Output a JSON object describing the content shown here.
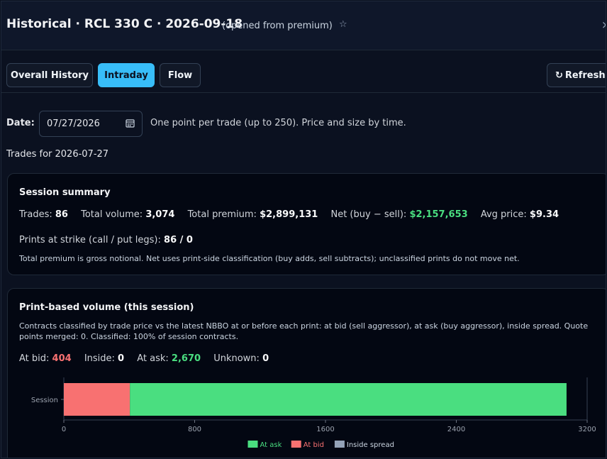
{
  "header": {
    "title": "Historical · RCL 330 C · 2026-09-18",
    "subtitle": "(opened from premium)",
    "star_icon": "☆",
    "close_icon": "×"
  },
  "tabs": [
    {
      "label": "Overall History",
      "active": false
    },
    {
      "label": "Intraday",
      "active": true
    },
    {
      "label": "Flow",
      "active": false
    }
  ],
  "refresh": {
    "icon": "↻",
    "label": "Refresh"
  },
  "date": {
    "label": "Date:",
    "value": "07/27/2026",
    "hint": "One point per trade (up to 250). Price and size by time."
  },
  "trades_for": "Trades for 2026-07-27",
  "session_summary": {
    "title": "Session summary",
    "trades_label": "Trades:",
    "trades": "86",
    "volume_label": "Total volume:",
    "volume": "3,074",
    "premium_label": "Total premium:",
    "premium": "$2,899,131",
    "net_label": "Net (buy − sell):",
    "net": "$2,157,653",
    "avg_label": "Avg price:",
    "avg": "$9.34",
    "prints_label": "Prints at strike (call / put legs):",
    "prints": "86 / 0",
    "note": "Total premium is gross notional. Net uses print-side classification (buy adds, sell subtracts); unclassified prints do not move net."
  },
  "print_volume": {
    "title": "Print-based volume (this session)",
    "description": "Contracts classified by trade price vs the latest NBBO at or before each print: at bid (sell aggressor), at ask (buy aggressor), inside spread. Quote points merged: 0. Classified: 100% of session contracts.",
    "at_bid_label": "At bid:",
    "at_bid": "404",
    "inside_label": "Inside:",
    "inside": "0",
    "at_ask_label": "At ask:",
    "at_ask": "2,670",
    "unknown_label": "Unknown:",
    "unknown": "0"
  },
  "chart_data": {
    "type": "bar",
    "orientation": "horizontal",
    "stacked": true,
    "categories": [
      "Session"
    ],
    "series": [
      {
        "name": "At bid",
        "values": [
          404
        ],
        "color": "#f87171"
      },
      {
        "name": "At ask",
        "values": [
          2670
        ],
        "color": "#4ade80"
      },
      {
        "name": "Inside spread",
        "values": [
          0
        ],
        "color": "#94a3b8"
      }
    ],
    "xlim": [
      0,
      3200
    ],
    "xticks": [
      0,
      800,
      1600,
      2400,
      3200
    ],
    "legend_order": [
      "At ask",
      "At bid",
      "Inside spread"
    ],
    "legend_position": "bottom-center",
    "grid": false
  }
}
